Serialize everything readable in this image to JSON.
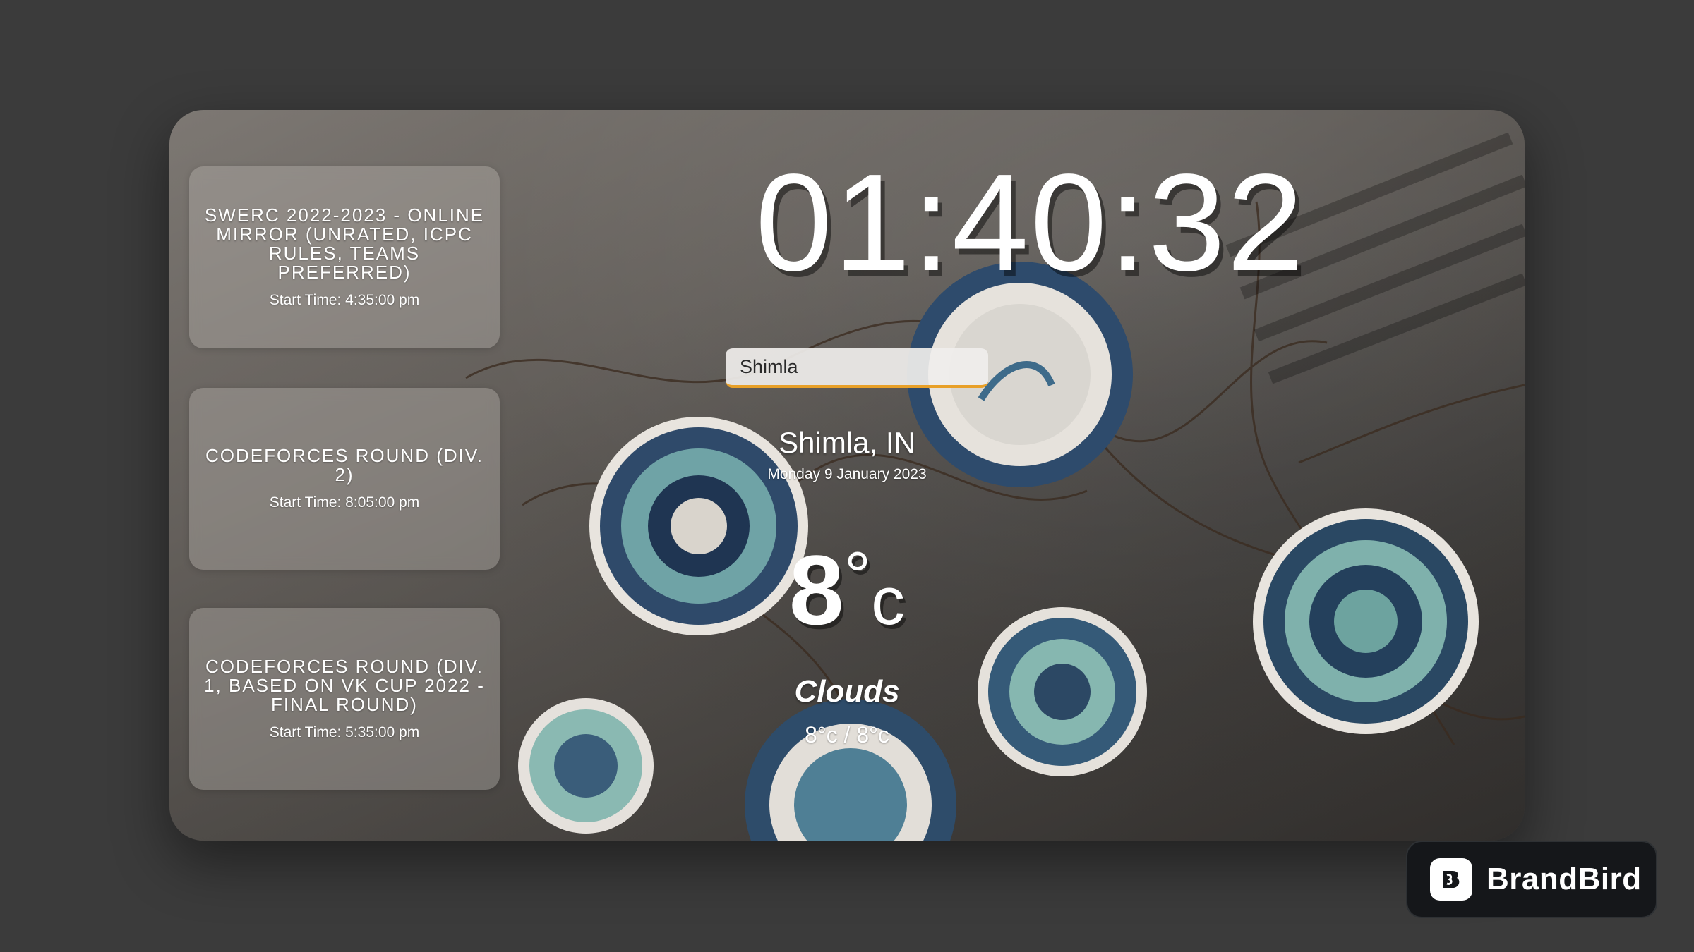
{
  "contests": [
    {
      "title": "SWERC 2022-2023 - ONLINE MIRROR (UNRATED, ICPC RULES, TEAMS PREFERRED)",
      "start_time": "Start Time: 4:35:00 pm"
    },
    {
      "title": "CODEFORCES ROUND (DIV. 2)",
      "start_time": "Start Time: 8:05:00 pm"
    },
    {
      "title": "CODEFORCES ROUND (DIV. 1, BASED ON VK CUP 2022 - FINAL ROUND)",
      "start_time": "Start Time: 5:35:00 pm"
    }
  ],
  "clock": {
    "time": "01:40:32"
  },
  "search": {
    "value": "Shimla"
  },
  "weather": {
    "location": "Shimla, IN",
    "date": "Monday 9 January 2023",
    "temp": "8",
    "deg_symbol": "°",
    "unit": "c",
    "condition": "Clouds",
    "range": "8°c / 8°c"
  },
  "brand": {
    "name": "BrandBird"
  },
  "colors": {
    "accent": "#e8a028",
    "page_bg": "#3b3b3b",
    "brand_bg": "#15171a"
  }
}
